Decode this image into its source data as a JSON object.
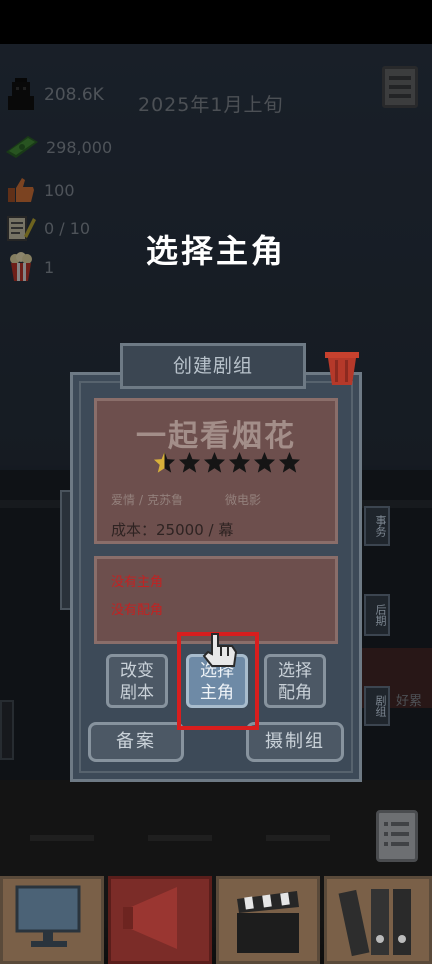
{
  "hud": {
    "followers": "208.6K",
    "date": "2025年1月上旬",
    "money": "298,000",
    "likes": "100",
    "scripts": "0 / 10",
    "popcorn": "1"
  },
  "overlay_title": "选择主角",
  "dialog": {
    "title": "创建剧组",
    "script_name": "一起看烟花",
    "stars_total": 6,
    "stars_filled": 0.5,
    "genre": "爱情",
    "writer": "克苏鲁",
    "format": "微电影",
    "cost_label": "成本：",
    "cost_value": "25000",
    "cost_unit": "/ 幕",
    "no_lead": "没有主角",
    "no_support": "没有配角",
    "btn_change_script": [
      "改变",
      "剧本"
    ],
    "btn_choose_lead": [
      "选择",
      "主角"
    ],
    "btn_choose_support": [
      "选择",
      "配角"
    ],
    "btn_file": "备案",
    "btn_crew": "摄制组",
    "side_tabs": [
      "事务",
      "后期",
      "剧组"
    ]
  },
  "street_sign": "好累",
  "colors": {
    "highlight": "#d81e1e",
    "script_card": "#6d4f4d",
    "missing_text": "#c22222"
  }
}
